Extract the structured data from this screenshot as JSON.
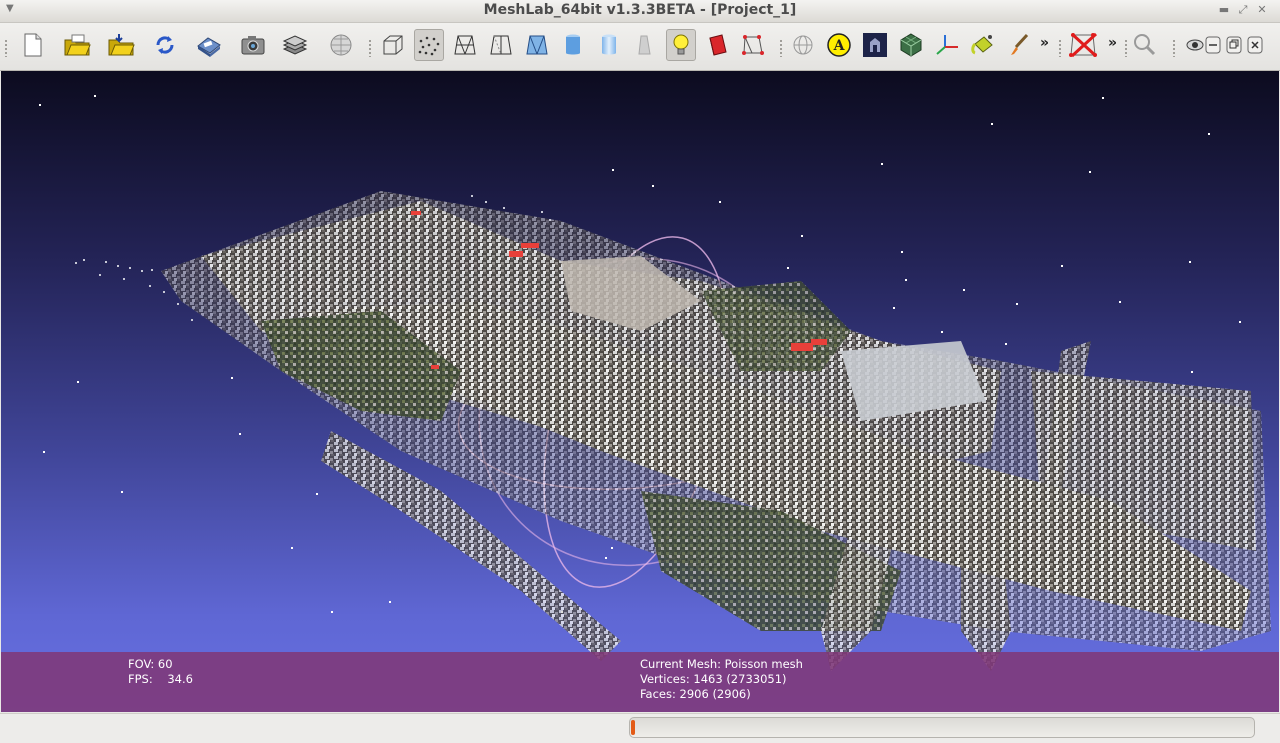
{
  "window": {
    "title": "MeshLab_64bit v1.3.3BETA - [Project_1]"
  },
  "toolbar": {
    "buttons": [
      {
        "name": "new-project-button",
        "icon": "new-document-icon"
      },
      {
        "name": "open-project-button",
        "icon": "open-project-folder-icon"
      },
      {
        "name": "import-mesh-button",
        "icon": "import-mesh-folder-icon"
      },
      {
        "name": "reload-button",
        "icon": "reload-icon"
      },
      {
        "name": "save-snapshot-button",
        "icon": "save-icon"
      },
      {
        "name": "snapshot-button",
        "icon": "camera-icon"
      },
      {
        "name": "layers-button",
        "icon": "layers-icon"
      },
      {
        "name": "raster-button",
        "icon": "globe-raster-icon"
      },
      {
        "name": "bounding-box-button",
        "icon": "bounding-box-icon"
      },
      {
        "name": "points-button",
        "icon": "points-icon",
        "active": true
      },
      {
        "name": "wireframe-button",
        "icon": "wireframe-icon"
      },
      {
        "name": "hidden-lines-button",
        "icon": "hidden-lines-icon"
      },
      {
        "name": "flat-lines-button",
        "icon": "flat-lines-icon"
      },
      {
        "name": "flat-button",
        "icon": "flat-shading-icon"
      },
      {
        "name": "smooth-button",
        "icon": "smooth-shading-icon"
      },
      {
        "name": "texture-button",
        "icon": "texture-icon"
      },
      {
        "name": "light-button",
        "icon": "light-bulb-icon",
        "active": true
      },
      {
        "name": "face-culling-button",
        "icon": "face-culling-icon"
      },
      {
        "name": "select-vertices-button",
        "icon": "select-vertices-icon"
      },
      {
        "name": "trackball-button",
        "icon": "trackball-icon"
      },
      {
        "name": "annotation-button",
        "icon": "annotation-a-icon"
      },
      {
        "name": "shader-button",
        "icon": "shader-icon"
      },
      {
        "name": "texture-map-button",
        "icon": "texture-map-icon"
      },
      {
        "name": "axis-button",
        "icon": "axis-icon"
      },
      {
        "name": "color-fill-button",
        "icon": "paint-bucket-icon"
      },
      {
        "name": "paint-button",
        "icon": "paint-brush-icon"
      }
    ],
    "second_group": [
      {
        "name": "delete-selection-button",
        "icon": "delete-vertices-icon"
      }
    ],
    "third_group": [
      {
        "name": "zoom-button",
        "icon": "magnifier-icon"
      },
      {
        "name": "mouse-eye-button",
        "icon": "eye-icon"
      },
      {
        "name": "minimize-subwindow-button",
        "icon": "minimize-icon"
      },
      {
        "name": "restore-subwindow-button",
        "icon": "restore-icon"
      },
      {
        "name": "close-subwindow-button",
        "icon": "close-icon"
      }
    ],
    "overflow_label": "»"
  },
  "viewport": {
    "info_left": {
      "fov": "FOV: 60",
      "fps": "FPS:    34.6"
    },
    "info_right": {
      "current_mesh": "Current Mesh: Poisson mesh",
      "vertices": "Vertices: 1463 (2733051)",
      "faces": "Faces: 2906 (2906)"
    },
    "colors": {
      "info_bar": "#803878",
      "sky_top": "#0c0b1f",
      "sky_bottom": "#6770e2"
    }
  },
  "statusbar": {
    "progress_fraction": 0.006,
    "progress_color": "#e35b17"
  }
}
